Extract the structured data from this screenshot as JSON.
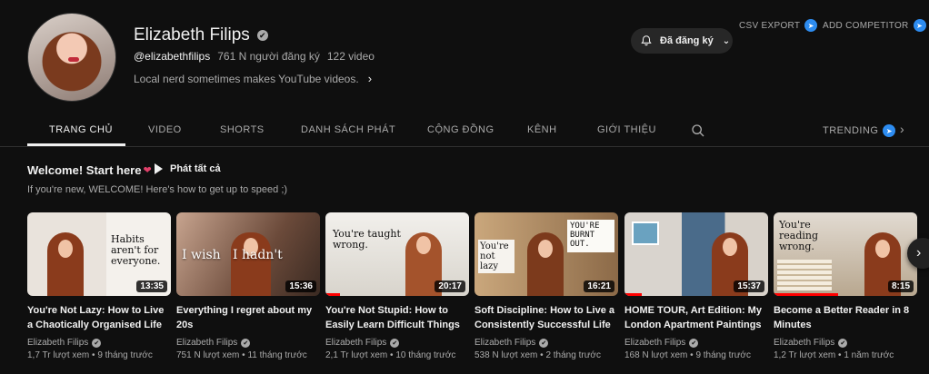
{
  "channel": {
    "name": "Elizabeth Filips",
    "handle": "@elizabethfilips",
    "subscribers": "761 N người đăng ký",
    "video_count": "122 video",
    "description": "Local nerd sometimes makes YouTube videos.",
    "verified_icon": "✔",
    "avatar_icon": "avatar-photo"
  },
  "subscribe": {
    "label": "Đã đăng ký",
    "icon": "bell-icon"
  },
  "actions": {
    "csv_export": "CSV EXPORT",
    "add_competitor": "ADD COMPETITOR",
    "badge_glyph": "➤"
  },
  "tabs": [
    {
      "label": "TRANG CHỦ"
    },
    {
      "label": "VIDEO"
    },
    {
      "label": "SHORTS"
    },
    {
      "label": "DANH SÁCH PHÁT"
    },
    {
      "label": "CỘNG ĐỒNG"
    },
    {
      "label": "KÊNH"
    },
    {
      "label": "GIỚI THIỆU"
    }
  ],
  "trending": "TRENDING",
  "shelf": {
    "title": "Welcome! Start here",
    "title_emoji": "❤",
    "play_all": "Phát tất cả",
    "description": "If you're new, WELCOME! Here's how to get up to speed ;)"
  },
  "videos": [
    {
      "title": "You're Not Lazy: How to Live a Chaotically Organised Life",
      "channel": "Elizabeth Filips",
      "stats": "1,7 Tr lượt xem • 9 tháng trước",
      "duration": "13:35",
      "overlay": "Habits aren't for everyone.",
      "progress": 0
    },
    {
      "title": "Everything I regret about my 20s",
      "channel": "Elizabeth Filips",
      "stats": "751 N lượt xem • 11 tháng trước",
      "duration": "15:36",
      "overlay": "I wish   I hadn't",
      "progress": 0
    },
    {
      "title": "You're Not Stupid: How to Easily Learn Difficult Things",
      "channel": "Elizabeth Filips",
      "stats": "2,1 Tr lượt xem • 10 tháng trước",
      "duration": "20:17",
      "overlay": "You're taught wrong.",
      "progress": 0.1
    },
    {
      "title": "Soft Discipline: How to Live a Consistently Successful Life",
      "channel": "Elizabeth Filips",
      "stats": "538 N lượt xem • 2 tháng trước",
      "duration": "16:21",
      "overlay": "You're not lazy",
      "overlay2": "YOU'RE BURNT OUT.",
      "progress": 0
    },
    {
      "title": "HOME TOUR, Art Edition: My London Apartment Paintings",
      "channel": "Elizabeth Filips",
      "stats": "168 N lượt xem • 9 tháng trước",
      "duration": "15:37",
      "overlay": "",
      "progress": 0.12
    },
    {
      "title": "Become a Better Reader in 8 Minutes",
      "channel": "Elizabeth Filips",
      "stats": "1,2 Tr lượt xem • 1 năm trước",
      "duration": "8:15",
      "overlay": "You're reading wrong.",
      "progress": 0.45
    }
  ],
  "colors": {
    "bg": "#0f0f0f",
    "text": "#f1f1f1",
    "muted": "#aaaaaa",
    "accent": "#2d8cf0",
    "progress": "#ff0000"
  }
}
